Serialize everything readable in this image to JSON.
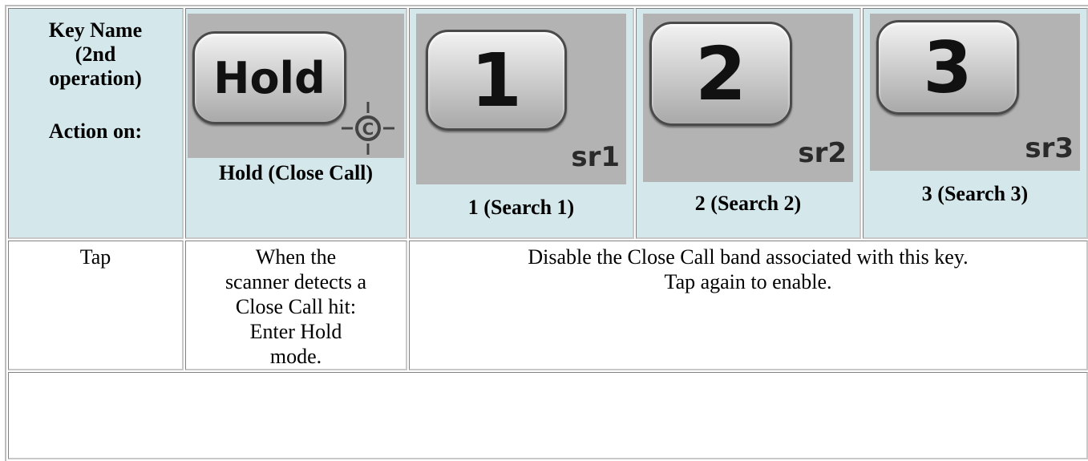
{
  "header": {
    "key_name_lines": [
      "Key Name",
      "(2nd",
      "operation)"
    ],
    "action_on": "Action on:"
  },
  "keys": [
    {
      "cap": "Hold",
      "sub": "",
      "icon": "close-call-icon",
      "label": "Hold (Close Call)"
    },
    {
      "cap": "1",
      "sub": "sr1",
      "label": "1 (Search 1)"
    },
    {
      "cap": "2",
      "sub": "sr2",
      "label": "2 (Search 2)"
    },
    {
      "cap": "3",
      "sub": "sr3",
      "label": "3 (Search 3)"
    }
  ],
  "rows": [
    {
      "action": "Tap",
      "hold_text": [
        "When the",
        "scanner detects a",
        "Close Call hit:",
        "Enter Hold",
        "mode."
      ],
      "search_text": [
        "Disable the Close Call band associated with this key.",
        "Tap again to enable."
      ]
    }
  ],
  "colors": {
    "header_bg": "#d4e8ec",
    "key_bg": "#b3b3b3"
  }
}
